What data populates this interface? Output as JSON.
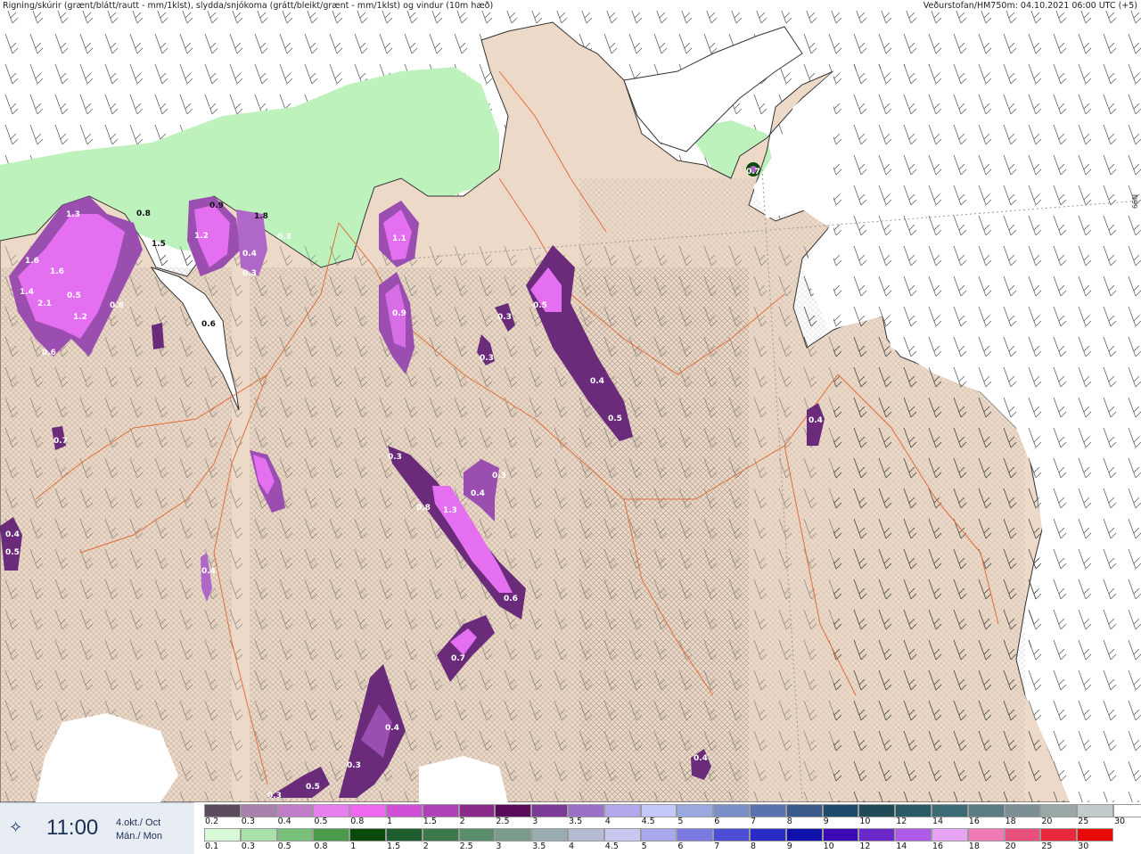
{
  "header": {
    "left_caption": "Rigning/skúrir (grænt/blátt/rautt - mm/1klst), slydda/snjókoma (grátt/bleikt/grænt - mm/1klst) og vindur (10m hæð)",
    "right_caption": "Veðurstofan/HM750m: 04.10.2021 06:00 UTC (+5)",
    "lat_label": "66N"
  },
  "footer": {
    "icon": "compass-star-icon",
    "time": "11:00",
    "date_line1": "4.okt./ Oct",
    "date_line2": "Mán./ Mon"
  },
  "colors": {
    "land": "#ecd9c7",
    "sea": "#ffffff",
    "light_green": "#bdf2bd",
    "mid_purple": "#9a4fb0",
    "dark_purple": "#6a2c7a",
    "magenta": "#e46ff0",
    "road": "#e0703a"
  },
  "scales": {
    "top": {
      "labels": [
        "0.2",
        "0.3",
        "0.4",
        "0.5",
        "0.8",
        "1",
        "1.5",
        "2",
        "2.5",
        "3",
        "3.5",
        "4",
        "4.5",
        "5",
        "6",
        "7",
        "8",
        "9",
        "10",
        "12",
        "14",
        "16",
        "18",
        "20",
        "25",
        "30"
      ],
      "colors": [
        "#5c4a5f",
        "#a882ac",
        "#c07cc6",
        "#e87ff0",
        "#f068f2",
        "#d04fd8",
        "#b040b8",
        "#8a2a8a",
        "#5a0a5a",
        "#7a3a96",
        "#9a70c8",
        "#b4a8ec",
        "#c4c8f8",
        "#9aa8e0",
        "#7a8ec8",
        "#5a72ae",
        "#3a5a8c",
        "#1e4a6c",
        "#204a56",
        "#2a5a66",
        "#3c6a74",
        "#5a7c84",
        "#7a8e94",
        "#9aa8a8",
        "#c2cccc",
        "#ffffff"
      ]
    },
    "bottom": {
      "labels": [
        "0.1",
        "0.3",
        "0.5",
        "0.8",
        "1",
        "1.5",
        "2",
        "2.5",
        "3",
        "3.5",
        "4",
        "4.5",
        "5",
        "6",
        "7",
        "8",
        "9",
        "10",
        "12",
        "14",
        "16",
        "18",
        "20",
        "25",
        "30"
      ],
      "colors": [
        "#d8f8d8",
        "#a8e0a8",
        "#78c078",
        "#4a9a4a",
        "#0a4a0a",
        "#1e5e2e",
        "#3c7a4c",
        "#5a8e6c",
        "#7a9c8c",
        "#9aacb0",
        "#b4bcd4",
        "#c8c8f0",
        "#a8a8ec",
        "#7a7ae0",
        "#4e4ed4",
        "#2a2ac4",
        "#1010aa",
        "#3c0ab4",
        "#6a28c8",
        "#b05ae8",
        "#e8a4f4",
        "#f07ab4",
        "#e8507c",
        "#e8283c",
        "#e80a0a"
      ]
    }
  },
  "map_labels": [
    {
      "text": "1.3"
    },
    {
      "text": "0.8"
    },
    {
      "text": "1.6"
    },
    {
      "text": "1.6"
    },
    {
      "text": "1.4"
    },
    {
      "text": "2.1"
    },
    {
      "text": "1.2"
    },
    {
      "text": "0.6"
    },
    {
      "text": "0.5"
    },
    {
      "text": "0.6"
    },
    {
      "text": "1.5"
    },
    {
      "text": "0.9"
    },
    {
      "text": "1.8"
    },
    {
      "text": "1.2"
    },
    {
      "text": "0.4"
    },
    {
      "text": "0.3"
    },
    {
      "text": "0.3"
    },
    {
      "text": "0.6"
    },
    {
      "text": "1.1"
    },
    {
      "text": "0.9"
    },
    {
      "text": "0.3"
    },
    {
      "text": "0.5"
    },
    {
      "text": "0.4"
    },
    {
      "text": "0.5"
    },
    {
      "text": "0.3"
    },
    {
      "text": "0.3"
    },
    {
      "text": "0.4"
    },
    {
      "text": "0.8"
    },
    {
      "text": "1.3"
    },
    {
      "text": "0.3"
    },
    {
      "text": "0.6"
    },
    {
      "text": "0.7"
    },
    {
      "text": "0.4"
    },
    {
      "text": "0.3"
    },
    {
      "text": "0.4"
    },
    {
      "text": "0.5"
    },
    {
      "text": "0.4"
    },
    {
      "text": "0.7"
    },
    {
      "text": "0.3"
    },
    {
      "text": "0.5"
    },
    {
      "text": "0.4"
    },
    {
      "text": "0.7"
    },
    {
      "text": "0.4"
    }
  ]
}
